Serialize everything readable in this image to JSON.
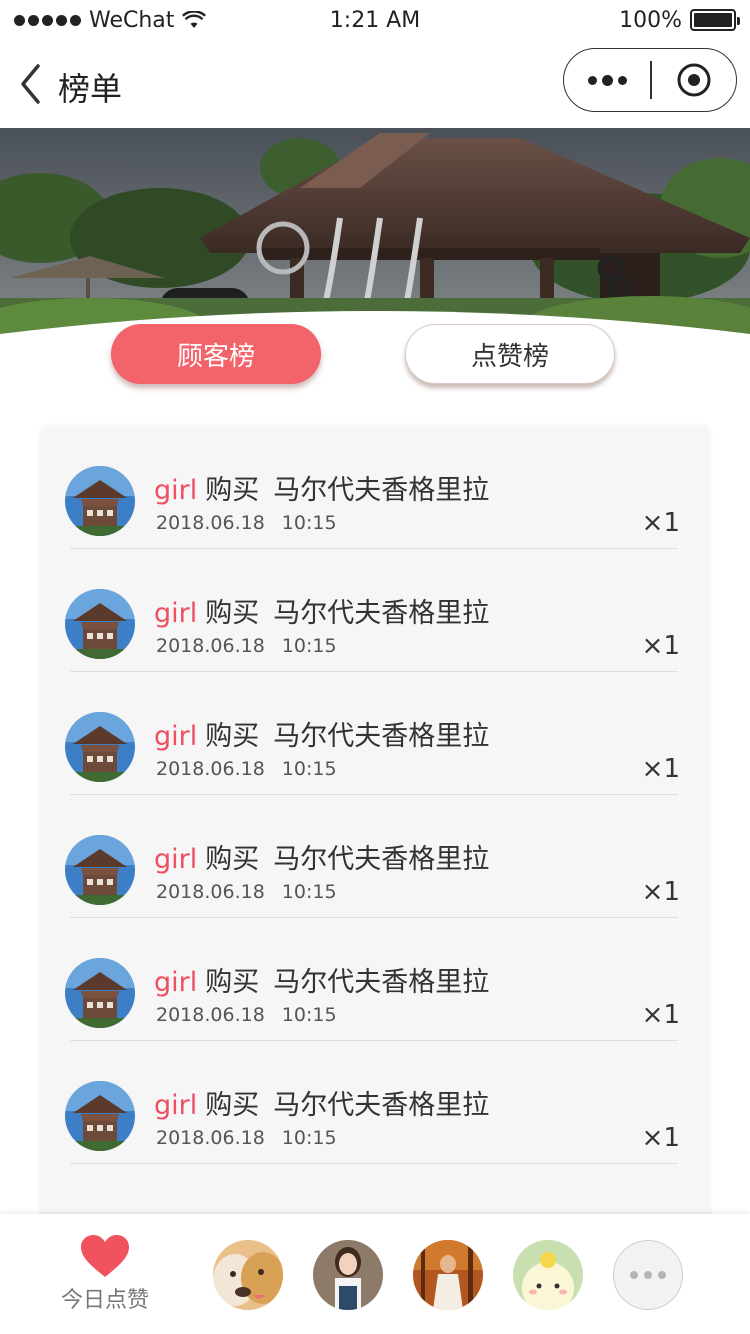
{
  "status_bar": {
    "carrier": "WeChat",
    "time": "1:21 AM",
    "battery": "100%",
    "battery_level": 1.0
  },
  "nav": {
    "title": "榜单"
  },
  "tabs": [
    {
      "label": "顾客榜",
      "active": true
    },
    {
      "label": "点赞榜",
      "active": false
    }
  ],
  "records": [
    {
      "user": "girl",
      "action": "购买",
      "product": "马尔代夫香格里拉",
      "date": "2018.06.18",
      "time": "10:15",
      "quantity": "×1"
    },
    {
      "user": "girl",
      "action": "购买",
      "product": "马尔代夫香格里拉",
      "date": "2018.06.18",
      "time": "10:15",
      "quantity": "×1"
    },
    {
      "user": "girl",
      "action": "购买",
      "product": "马尔代夫香格里拉",
      "date": "2018.06.18",
      "time": "10:15",
      "quantity": "×1"
    },
    {
      "user": "girl",
      "action": "购买",
      "product": "马尔代夫香格里拉",
      "date": "2018.06.18",
      "time": "10:15",
      "quantity": "×1"
    },
    {
      "user": "girl",
      "action": "购买",
      "product": "马尔代夫香格里拉",
      "date": "2018.06.18",
      "time": "10:15",
      "quantity": "×1"
    },
    {
      "user": "girl",
      "action": "购买",
      "product": "马尔代夫香格里拉",
      "date": "2018.06.18",
      "time": "10:15",
      "quantity": "×1"
    }
  ],
  "bottom_bar": {
    "like_label": "今日点赞",
    "like_icon": "heart-icon"
  },
  "colors": {
    "accent": "#f2636a",
    "username": "#ee4f61",
    "heart": "#f0535e"
  }
}
